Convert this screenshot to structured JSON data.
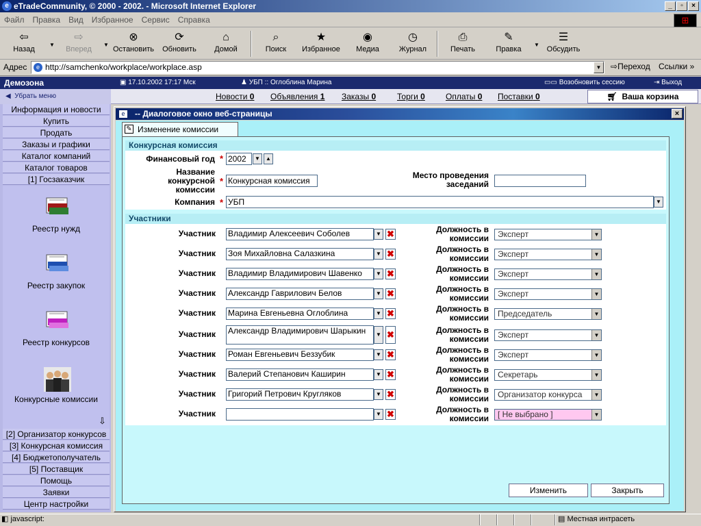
{
  "window": {
    "title": "eTradeCommunity, © 2000 - 2002. - Microsoft Internet Explorer"
  },
  "menu": [
    "Файл",
    "Правка",
    "Вид",
    "Избранное",
    "Сервис",
    "Справка"
  ],
  "toolbar": {
    "back": "Назад",
    "forward": "Вперед",
    "stop": "Остановить",
    "refresh": "Обновить",
    "home": "Домой",
    "search": "Поиск",
    "favorites": "Избранное",
    "media": "Медиа",
    "history": "Журнал",
    "print": "Печать",
    "edit": "Правка",
    "discuss": "Обсудить"
  },
  "address": {
    "label": "Адрес",
    "url": "http://samchenko/workplace/workplace.asp",
    "go": "Переход",
    "links": "Ссылки"
  },
  "app": {
    "brand": "Демозона",
    "datetime": "17.10.2002  17:17 Мск",
    "user": "УБП :: Оглоблина Марина",
    "resume": "Возобновить сессию",
    "exit": "Выход",
    "hide_menu": "Убрать меню",
    "cart": "Ваша корзина"
  },
  "nav": [
    {
      "label": "Новости",
      "count": "0"
    },
    {
      "label": "Объявления",
      "count": "1"
    },
    {
      "label": "Заказы",
      "count": "0"
    },
    {
      "label": "Торги",
      "count": "0"
    },
    {
      "label": "Оплаты",
      "count": "0"
    },
    {
      "label": "Поставки",
      "count": "0"
    }
  ],
  "sidebar": {
    "top_items": [
      "Информация и новости",
      "Купить",
      "Продать",
      "Заказы и графики",
      "Каталог компаний",
      "Каталог товаров",
      "[1] Госзаказчик"
    ],
    "panel_items": [
      "Реестр нужд",
      "Реестр закупок",
      "Реестр конкурсов",
      "Конкурсные комиссии"
    ],
    "bottom_items": [
      "[2] Организатор конкурсов",
      "[3] Конкурсная комиссия",
      "[4] Бюджетополучатель",
      "[5] Поставщик",
      "Помощь",
      "Заявки",
      "Центр настройки"
    ]
  },
  "dialog": {
    "title": "-- Диалоговое окно веб-страницы",
    "tab": "Изменение комиссии",
    "section1": "Конкурсная комиссия",
    "year_label": "Финансовый год",
    "year_value": "2002",
    "name_label": "Название конкурсной комиссии",
    "name_value": "Конкурсная комиссия",
    "place_label": "Место проведения заседаний",
    "place_value": "",
    "company_label": "Компания",
    "company_value": "УБП",
    "section2": "Участники",
    "participant_label": "Участник",
    "role_label": "Должность в комиссии",
    "participants": [
      {
        "name": "Владимир Алексеевич Соболев",
        "role": "Эксперт"
      },
      {
        "name": "Зоя Михайловна Салазкина",
        "role": "Эксперт"
      },
      {
        "name": "Владимир Владимирович Шавенко",
        "role": "Эксперт"
      },
      {
        "name": "Александр Гаврилович Белов",
        "role": "Эксперт"
      },
      {
        "name": "Марина Евгеньевна Оглоблина",
        "role": "Председатель"
      },
      {
        "name": "Александр Владимирович Шарыкин",
        "role": "Эксперт"
      },
      {
        "name": "Роман Евгеньевич Беззубик",
        "role": "Эксперт"
      },
      {
        "name": "Валерий Степанович Каширин",
        "role": "Секретарь"
      },
      {
        "name": "Григорий Петрович Кругляков",
        "role": "Организатор конкурса"
      },
      {
        "name": "",
        "role": "[ Не выбрано ]"
      }
    ],
    "btn_change": "Изменить",
    "btn_close": "Закрыть"
  },
  "status": {
    "left": "javascript:",
    "right": "Местная интрасеть"
  },
  "colors": {
    "dialog_bg": "#aaf0f8",
    "sidebar_bg": "#b8b8e6",
    "header_bg": "#1b2a6e",
    "delete_red": "#d00000",
    "unselected_role_bg": "#ffc8f0"
  }
}
